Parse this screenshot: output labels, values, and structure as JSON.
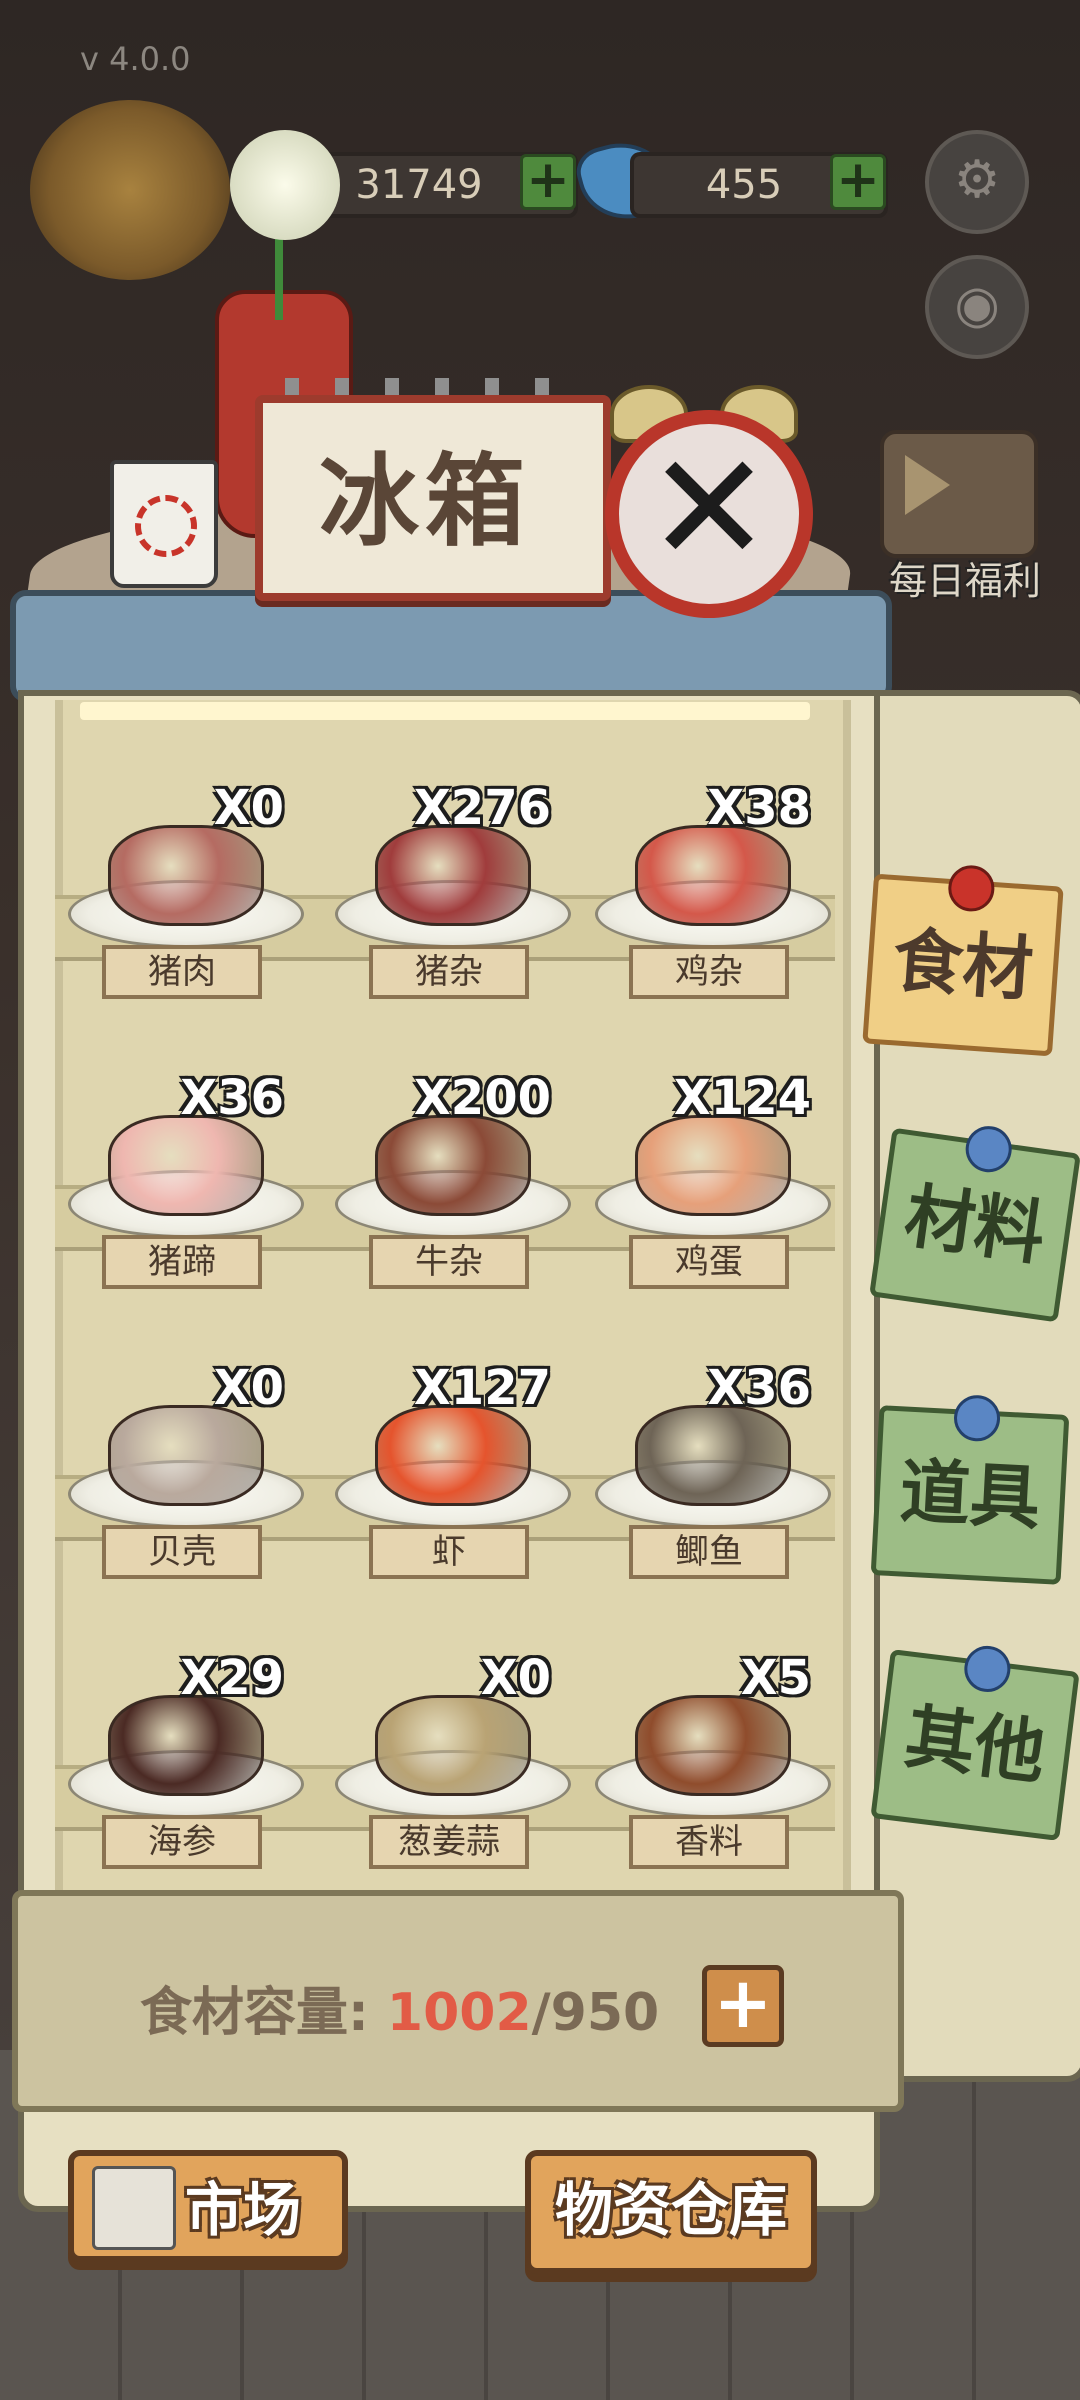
{
  "version": "v 4.0.0",
  "hud": {
    "coins": "31749",
    "gems": "455"
  },
  "title": "冰箱",
  "daily_welfare": "每日福利",
  "tabs": [
    {
      "label": "食材",
      "active": true
    },
    {
      "label": "材料",
      "active": false
    },
    {
      "label": "道具",
      "active": false
    },
    {
      "label": "其他",
      "active": false
    }
  ],
  "items": [
    {
      "name": "猪肉",
      "count": "X0",
      "color": "#b56b62"
    },
    {
      "name": "猪杂",
      "count": "X276",
      "color": "#a03c3c"
    },
    {
      "name": "鸡杂",
      "count": "X38",
      "color": "#d4584a"
    },
    {
      "name": "猪蹄",
      "count": "X36",
      "color": "#efb7b0"
    },
    {
      "name": "牛杂",
      "count": "X200",
      "color": "#8b4a37"
    },
    {
      "name": "鸡蛋",
      "count": "X124",
      "color": "#e6a07a"
    },
    {
      "name": "贝壳",
      "count": "X0",
      "color": "#b9a99d"
    },
    {
      "name": "虾",
      "count": "X127",
      "color": "#e5542d"
    },
    {
      "name": "鲫鱼",
      "count": "X36",
      "color": "#6e6456"
    },
    {
      "name": "海参",
      "count": "X29",
      "color": "#4b2a24"
    },
    {
      "name": "葱姜蒜",
      "count": "X0",
      "color": "#b9a374"
    },
    {
      "name": "香料",
      "count": "X5",
      "color": "#8f4c2c"
    }
  ],
  "capacity": {
    "label": "食材容量:",
    "current": "1002",
    "max": "/950"
  },
  "buttons": {
    "market": "市场",
    "warehouse": "物资仓库"
  },
  "colors": {
    "accent_tab": "#f0cf86",
    "capacity_over": "#e25b46"
  }
}
